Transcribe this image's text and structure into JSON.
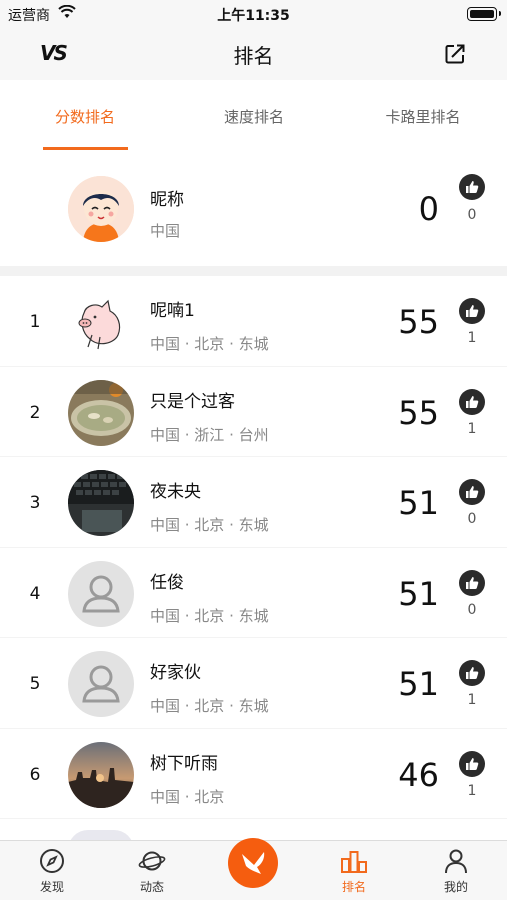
{
  "status_bar": {
    "carrier": "运营商",
    "time": "上午11:35"
  },
  "nav": {
    "left_logo": "VS",
    "title": "排名"
  },
  "tabs": [
    {
      "label": "分数排名",
      "active": true
    },
    {
      "label": "速度排名",
      "active": false
    },
    {
      "label": "卡路里排名",
      "active": false
    }
  ],
  "me": {
    "name": "昵称",
    "location": "中国",
    "score": "0",
    "likes": "0"
  },
  "rankings": [
    {
      "rank": "1",
      "name": "呢喃1",
      "location": "中国 · 北京 · 东城",
      "score": "55",
      "likes": "1"
    },
    {
      "rank": "2",
      "name": "只是个过客",
      "location": "中国 · 浙江 · 台州",
      "score": "55",
      "likes": "1"
    },
    {
      "rank": "3",
      "name": "夜未央",
      "location": "中国 · 北京 · 东城",
      "score": "51",
      "likes": "0"
    },
    {
      "rank": "4",
      "name": "任俊",
      "location": "中国 · 北京 · 东城",
      "score": "51",
      "likes": "0"
    },
    {
      "rank": "5",
      "name": "好家伙",
      "location": "中国 · 北京 · 东城",
      "score": "51",
      "likes": "1"
    },
    {
      "rank": "6",
      "name": "树下听雨",
      "location": "中国 · 北京",
      "score": "46",
      "likes": "1"
    }
  ],
  "tabbar": [
    {
      "label": "发现",
      "icon": "compass-icon"
    },
    {
      "label": "动态",
      "icon": "planet-icon"
    },
    {
      "label": "",
      "icon": "bird-icon"
    },
    {
      "label": "排名",
      "icon": "podium-icon"
    },
    {
      "label": "我的",
      "icon": "person-icon"
    }
  ],
  "colors": {
    "accent": "#f26a1d",
    "center_button": "#f55d0f"
  }
}
